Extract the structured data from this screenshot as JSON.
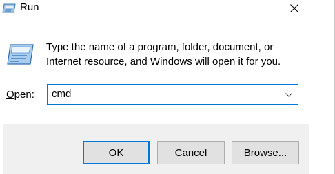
{
  "window": {
    "title": "Run",
    "title_icon": "run-icon",
    "close_icon": "close-icon"
  },
  "message": {
    "icon": "run-icon",
    "text": "Type the name of a program, folder, document, or Internet resource, and Windows will open it for you."
  },
  "open_field": {
    "label_underlined": "O",
    "label_rest": "pen:",
    "value": "cmd",
    "dropdown_icon": "chevron-down-icon"
  },
  "buttons": {
    "ok": "OK",
    "cancel": "Cancel",
    "browse_underlined": "B",
    "browse_rest": "rowse..."
  },
  "colors": {
    "accent": "#0078d7",
    "footer_bg": "#f0f0f0",
    "button_bg": "#e1e1e1",
    "button_border": "#adadad"
  }
}
